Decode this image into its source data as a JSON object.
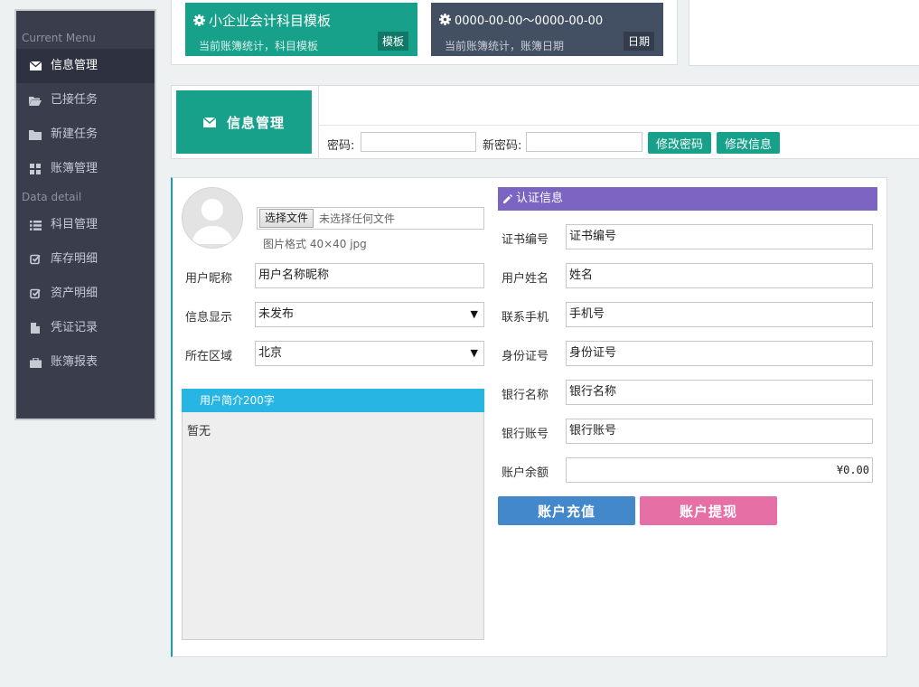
{
  "sidebar": {
    "section1": "Current Menu",
    "section2": "Data  detail",
    "items1": [
      {
        "label": "信息管理",
        "icon": "envelope-icon"
      },
      {
        "label": "已接任务",
        "icon": "folder-open-icon"
      },
      {
        "label": "新建任务",
        "icon": "folder-icon"
      },
      {
        "label": "账簿管理",
        "icon": "grid-icon"
      }
    ],
    "items2": [
      {
        "label": "科目管理",
        "icon": "list-icon"
      },
      {
        "label": "库存明细",
        "icon": "check-square-icon"
      },
      {
        "label": "资产明细",
        "icon": "check-square-icon"
      },
      {
        "label": "凭证记录",
        "icon": "file-icon"
      },
      {
        "label": "账簿报表",
        "icon": "briefcase-icon"
      }
    ]
  },
  "cards": [
    {
      "title": "小企业会计科目模板",
      "subtitle": "当前账簿统计，科目模板",
      "badge": "模板",
      "color": "#17a08a"
    },
    {
      "title": "0000-00-00〜0000-00-00",
      "subtitle": "当前账簿统计，账簿日期",
      "badge": "日期",
      "color": "#435064"
    }
  ],
  "infobar": {
    "title": "信息管理",
    "password_label": "密码:",
    "new_password_label": "新密码:",
    "change_password_btn": "修改密码",
    "change_info_btn": "修改信息"
  },
  "profile": {
    "file_button": "选择文件",
    "file_placeholder": "未选择任何文件",
    "image_hint": "图片格式 40×40 jpg",
    "nickname_label": "用户昵称",
    "nickname_value": "用户名称昵称",
    "display_label": "信息显示",
    "display_value": "未发布",
    "region_label": "所在区域",
    "region_value": "北京",
    "intro_title": "用户简介200字",
    "intro_value": "暂无"
  },
  "cert": {
    "title": "认证信息",
    "fields": [
      {
        "label": "证书编号",
        "value": "证书编号"
      },
      {
        "label": "用户姓名",
        "value": "姓名"
      },
      {
        "label": "联系手机",
        "value": "手机号"
      },
      {
        "label": "身份证号",
        "value": "身份证号"
      },
      {
        "label": "银行名称",
        "value": "银行名称"
      },
      {
        "label": "银行账号",
        "value": "银行账号"
      },
      {
        "label": "账户余额",
        "value": "¥0.00"
      }
    ],
    "recharge_btn": "账户充值",
    "withdraw_btn": "账户提现"
  }
}
